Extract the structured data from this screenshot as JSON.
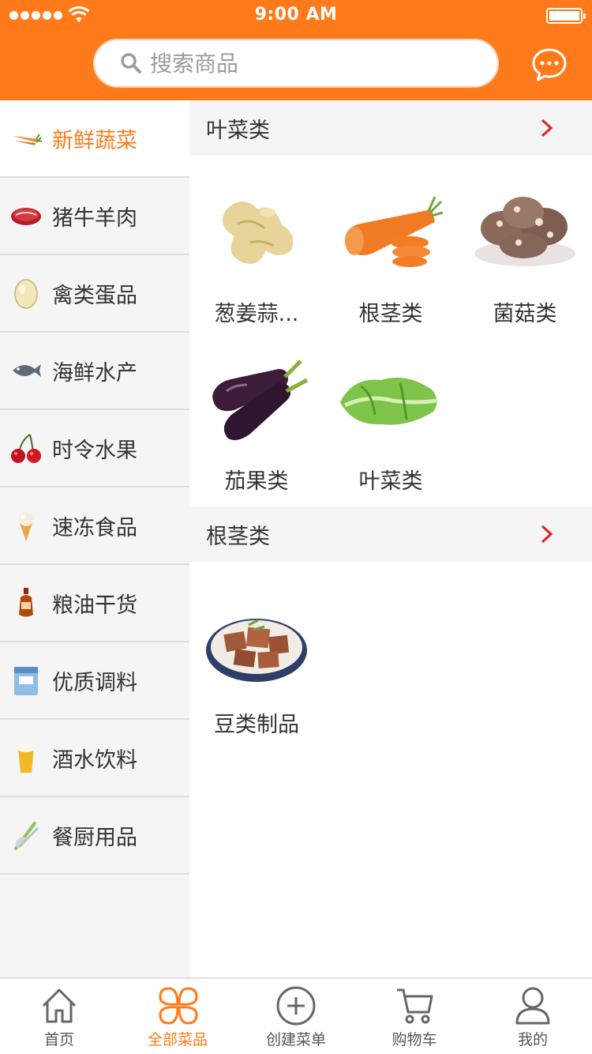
{
  "status_bar": {
    "time": "9:00 AM"
  },
  "search": {
    "placeholder": "搜索商品"
  },
  "colors": {
    "accent": "#ff7a1a",
    "chevron": "#e02020",
    "sidebar_bg": "#f5f5f5"
  },
  "sidebar": {
    "items": [
      {
        "label": "新鲜蔬菜",
        "icon": "carrot-icon",
        "active": true
      },
      {
        "label": "猪牛羊肉",
        "icon": "meat-icon"
      },
      {
        "label": "禽类蛋品",
        "icon": "egg-icon"
      },
      {
        "label": "海鲜水产",
        "icon": "fish-icon"
      },
      {
        "label": "时令水果",
        "icon": "cherry-icon"
      },
      {
        "label": "速冻食品",
        "icon": "ice-cream-icon"
      },
      {
        "label": "粮油干货",
        "icon": "oil-bottle-icon"
      },
      {
        "label": "优质调料",
        "icon": "salt-bag-icon"
      },
      {
        "label": "酒水饮料",
        "icon": "beer-icon"
      },
      {
        "label": "餐厨用品",
        "icon": "utensils-icon"
      }
    ]
  },
  "sections": [
    {
      "title": "叶菜类",
      "items": [
        {
          "label": "葱姜蒜...",
          "icon": "ginger-icon"
        },
        {
          "label": "根茎类",
          "icon": "carrot-slices-icon"
        },
        {
          "label": "菌菇类",
          "icon": "mushroom-icon"
        },
        {
          "label": "茄果类",
          "icon": "eggplant-icon"
        },
        {
          "label": "叶菜类",
          "icon": "lettuce-icon"
        }
      ]
    },
    {
      "title": "根茎类",
      "items": [
        {
          "label": "豆类制品",
          "icon": "tofu-bowl-icon"
        }
      ]
    }
  ],
  "tabbar": {
    "items": [
      {
        "label": "首页",
        "icon": "home-icon"
      },
      {
        "label": "全部菜品",
        "icon": "clover-icon",
        "active": true
      },
      {
        "label": "创建菜单",
        "icon": "plus-circle-icon"
      },
      {
        "label": "购物车",
        "icon": "cart-icon"
      },
      {
        "label": "我的",
        "icon": "user-icon"
      }
    ]
  }
}
